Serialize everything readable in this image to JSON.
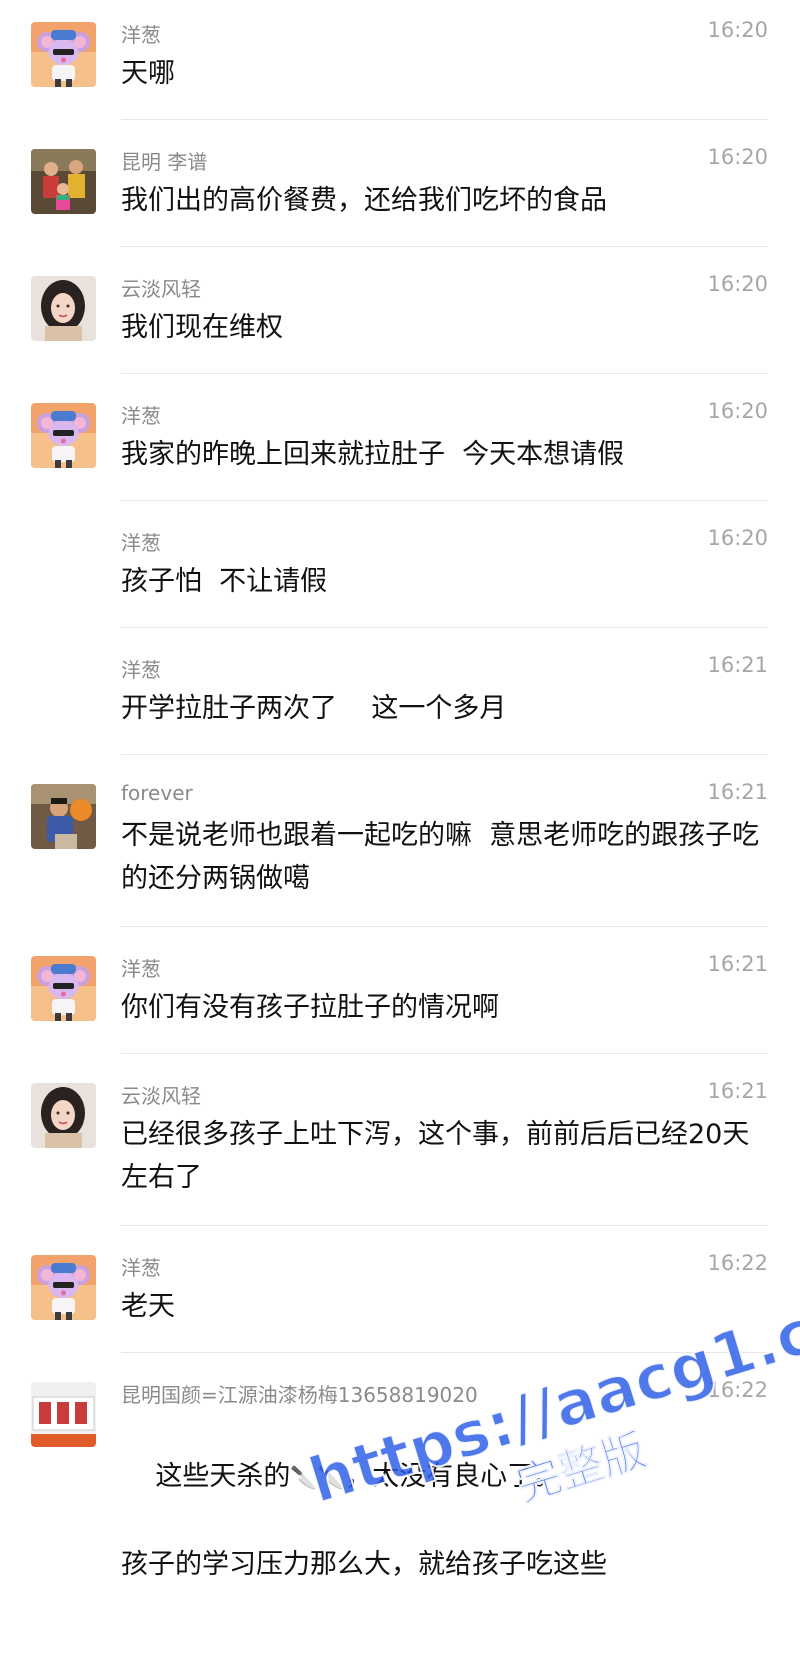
{
  "messages": [
    {
      "sender": "洋葱",
      "time": "16:20",
      "text": "天哪"
    },
    {
      "sender": "昆明 李谱",
      "time": "16:20",
      "text": "我们出的高价餐费，还给我们吃坏的食品"
    },
    {
      "sender": "云淡风轻",
      "time": "16:20",
      "text": "我们现在维权"
    },
    {
      "sender": "洋葱",
      "time": "16:20",
      "text": "我家的昨晚上回来就拉肚子  今天本想请假"
    },
    {
      "sender": "洋葱",
      "time": "16:20",
      "text": "孩子怕  不让请假"
    },
    {
      "sender": "洋葱",
      "time": "16:21",
      "text": "开学拉肚子两次了    这一个多月"
    },
    {
      "sender": "forever",
      "time": "16:21",
      "text": "不是说老师也跟着一起吃的嘛  意思老师吃的跟孩子吃的还分两锅做噶"
    },
    {
      "sender": "洋葱",
      "time": "16:21",
      "text": "你们有没有孩子拉肚子的情况啊"
    },
    {
      "sender": "云淡风轻",
      "time": "16:21",
      "text": "已经很多孩子上吐下泻，这个事，前前后后已经20天左右了"
    },
    {
      "sender": "洋葱",
      "time": "16:22",
      "text": "老天"
    },
    {
      "sender": "昆明国颜=江源油漆杨梅13658819020",
      "time": "16:22",
      "text_before": "这些天杀的",
      "text_after": "，太没有良心了。",
      "text_line2": "孩子的学习压力那么大，就给孩子吃这些"
    }
  ],
  "avatars": {
    "onion": "cartoon-mouse-avatar",
    "li_pu": "family-photo-avatar",
    "yundan": "woman-portrait-avatar",
    "forever": "child-photo-avatar",
    "guoyan": "paint-shop-avatar"
  },
  "avatar_sign_text": "油漆专家",
  "emoji": [
    "knife-icon",
    "knife-icon"
  ],
  "watermark": {
    "main": "https://aacg1.com",
    "sub": "完整版"
  },
  "colors": {
    "name": "#8a8a8a",
    "time": "#a6a6a6",
    "text": "#111111",
    "divider": "#e6e6e6",
    "watermark": "#2a5ae6"
  }
}
